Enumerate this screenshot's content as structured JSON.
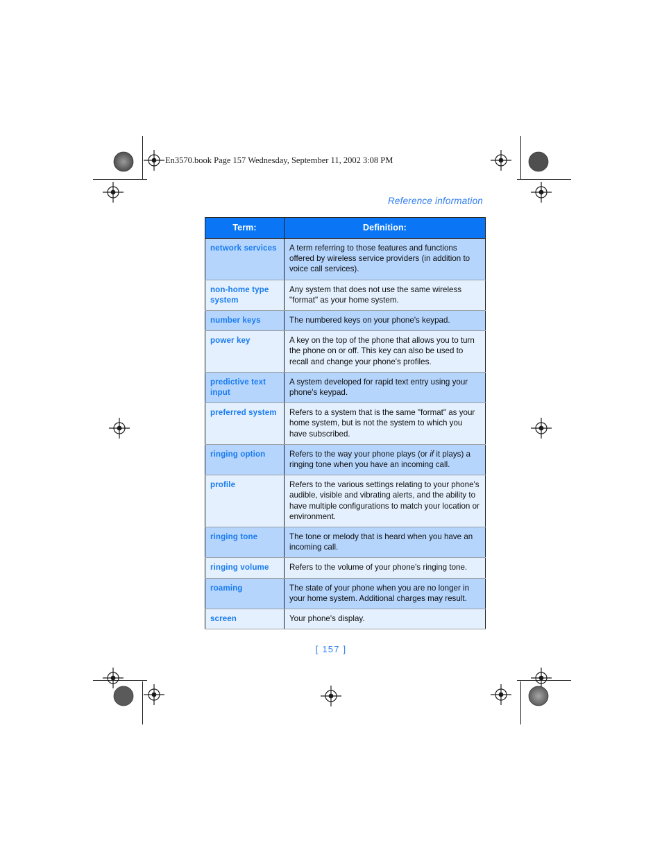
{
  "document": {
    "filestamp": "En3570.book  Page 157  Wednesday, September 11, 2002  3:08 PM",
    "running_head": "Reference information",
    "page_number": "[ 157 ]"
  },
  "colors": {
    "header_blue": "#0a76f6",
    "term_blue": "#1a7cf0",
    "row_dark": "#b5d5fd",
    "row_light": "#e4f0fd",
    "running_head_blue": "#2f7ef0",
    "border_black": "#1b1b1b"
  },
  "glossary": {
    "columns": [
      "Term:",
      "Definition:"
    ],
    "rows": [
      {
        "term": "network services",
        "definition": "A term referring to those features and functions offered by wireless service providers (in addition to voice call services).",
        "shade": "dark"
      },
      {
        "term": "non-home type system",
        "definition": "Any system that does not use the same wireless \"format\" as your home system.",
        "shade": "light"
      },
      {
        "term": "number keys",
        "definition": "The numbered keys on your phone's keypad.",
        "shade": "dark"
      },
      {
        "term": "power key",
        "definition": "A key on the top of the phone that allows you to turn the phone on or off. This key can also be used to recall and change your phone's profiles.",
        "shade": "light"
      },
      {
        "term": "predictive text input",
        "definition": "A system developed for rapid text entry using your phone's keypad.",
        "shade": "dark"
      },
      {
        "term": "preferred system",
        "definition": "Refers to a system that is the same \"format\" as your home system, but is not the system to which you have subscribed.",
        "shade": "light"
      },
      {
        "term": "ringing option",
        "definition_pre": "Refers to the way your phone plays (or ",
        "definition_em": "if",
        "definition_post": " it plays) a ringing tone when you have an incoming call.",
        "definition": "Refers to the way your phone plays (or if it plays) a ringing tone when you have an incoming call.",
        "shade": "dark"
      },
      {
        "term": "profile",
        "definition": "Refers to the various settings relating to your phone's audible, visible and vibrating alerts, and the ability to have multiple configurations to match your location or environment.",
        "shade": "light"
      },
      {
        "term": "ringing tone",
        "definition": "The tone or melody that is heard when you have an incoming call.",
        "shade": "dark"
      },
      {
        "term": "ringing volume",
        "definition": "Refers to the volume of your phone's ringing tone.",
        "shade": "light"
      },
      {
        "term": "roaming",
        "definition": "The state of your phone when you are no longer in your home system. Additional charges may result.",
        "shade": "dark"
      },
      {
        "term": "screen",
        "definition": "Your phone's display.",
        "shade": "light"
      }
    ]
  }
}
